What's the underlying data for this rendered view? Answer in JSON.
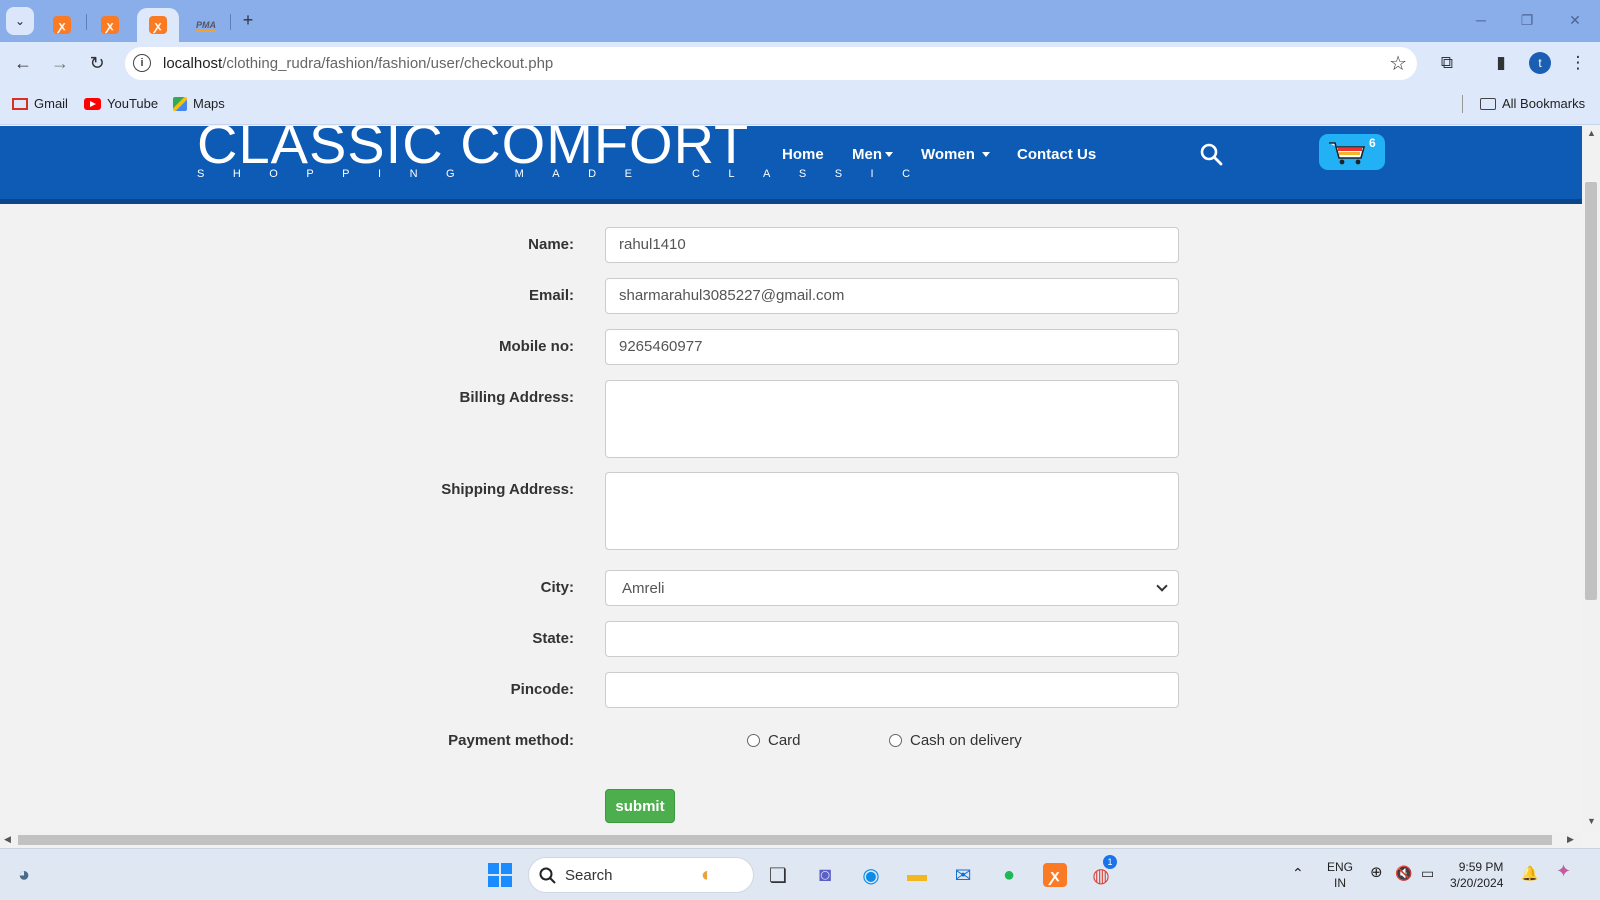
{
  "browser": {
    "url_host": "localhost",
    "url_path": "/clothing_rudra/fashion/fashion/user/checkout.php",
    "bookmarks": [
      "Gmail",
      "YouTube",
      "Maps"
    ],
    "all_bookmarks": "All Bookmarks",
    "profile_initial": "t",
    "tab_icon_pma": "PMA"
  },
  "site": {
    "logo": "CLASSIC COMFORT",
    "tagline": "SHOPPING MADE CLASSIC",
    "nav": {
      "home": "Home",
      "men": "Men",
      "women": "Women",
      "contact": "Contact Us"
    },
    "cart_count": "6",
    "header_color": "#0d5bb5"
  },
  "form": {
    "name_label": "Name:",
    "name_value": "rahul1410",
    "email_label": "Email:",
    "email_value": "sharmarahul3085227@gmail.com",
    "mobile_label": "Mobile no:",
    "mobile_value": "9265460977",
    "billing_label": "Billing Address:",
    "billing_value": "",
    "shipping_label": "Shipping Address:",
    "shipping_value": "",
    "city_label": "City:",
    "city_value": "Amreli",
    "state_label": "State:",
    "state_value": "",
    "pincode_label": "Pincode:",
    "pincode_value": "",
    "payment_label": "Payment method:",
    "payment_card": "Card",
    "payment_cod": "Cash on delivery",
    "submit_label": "submit",
    "submit_color": "#4cae4c"
  },
  "taskbar": {
    "search_label": "Search",
    "lang": "ENG",
    "region": "IN",
    "time": "9:59 PM",
    "date": "3/20/2024",
    "chrome_badge": "1"
  }
}
